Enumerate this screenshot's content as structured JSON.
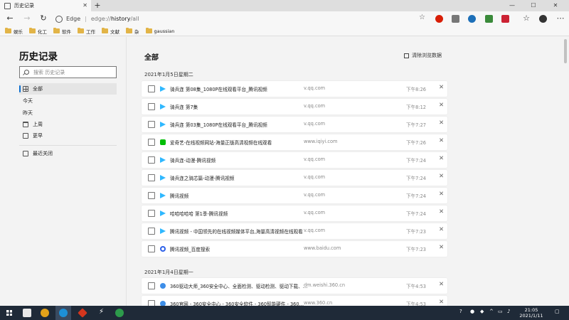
{
  "browser": {
    "tab_title": "历史记录",
    "address_scheme": "Edge",
    "address_prefix": "edge://",
    "address_host": "history",
    "address_path": "/all"
  },
  "favorites": [
    "娱乐",
    "化工",
    "软件",
    "工作",
    "文献",
    "杂",
    "gaussian"
  ],
  "sidebar": {
    "title": "历史记录",
    "search_placeholder": "搜索 历史记录",
    "items": [
      {
        "label": "全部",
        "icon": "grid-icon",
        "active": true
      },
      {
        "label": "今天",
        "icon": "clock-icon"
      },
      {
        "label": "昨天",
        "icon": "clock-icon"
      },
      {
        "label": "上周",
        "icon": "calendar-icon"
      },
      {
        "label": "更早",
        "icon": "box-icon"
      },
      {
        "label": "最近关闭",
        "icon": "closed-tabs-icon"
      }
    ]
  },
  "main": {
    "title": "全部",
    "clear_label": "清除浏览数据",
    "groups": [
      {
        "date": "2021年1月5日星期二",
        "entries": [
          {
            "title": "骑兵连 第08集_1080P在线观看平台_腾讯视频",
            "domain": "v.qq.com",
            "time": "下午8:26",
            "icon": "tencent-video-icon"
          },
          {
            "title": "骑兵连 第7集",
            "domain": "v.qq.com",
            "time": "下午8:12",
            "icon": "tencent-video-icon"
          },
          {
            "title": "骑兵连 第03集_1080P在线观看平台_腾讯视频",
            "domain": "v.qq.com",
            "time": "下午7:27",
            "icon": "tencent-video-icon"
          },
          {
            "title": "爱奇艺-在线视频网站-海量正版高清视频在线观看",
            "domain": "www.iqiyi.com",
            "time": "下午7:26",
            "icon": "iqiyi-icon"
          },
          {
            "title": "骑兵连-动漫-腾讯视频",
            "domain": "v.qq.com",
            "time": "下午7:24",
            "icon": "tencent-video-icon"
          },
          {
            "title": "骑兵连之骑芯篇-动漫-腾讯视频",
            "domain": "v.qq.com",
            "time": "下午7:24",
            "icon": "tencent-video-icon"
          },
          {
            "title": "腾讯视频",
            "domain": "v.qq.com",
            "time": "下午7:24",
            "icon": "tencent-video-icon"
          },
          {
            "title": "哈哈哈哈哈 第1季-腾讯视频",
            "domain": "v.qq.com",
            "time": "下午7:24",
            "icon": "tencent-video-icon"
          },
          {
            "title": "腾讯视频 - 中国领先的在线视频媒体平台,海量高清视频在线观看",
            "domain": "v.qq.com",
            "time": "下午7:23",
            "icon": "tencent-video-icon"
          },
          {
            "title": "腾讯视频_百度搜索",
            "domain": "www.baidu.com",
            "time": "下午7:23",
            "icon": "baidu-icon"
          }
        ]
      },
      {
        "date": "2021年1月4日星期一",
        "entries": [
          {
            "title": "360驱动大师_360安全中心、全面检测、驱动检测、驱动下载、…",
            "domain": "dm.weishi.360.cn",
            "time": "下午4:53",
            "icon": "360-icon"
          },
          {
            "title": "360官网 - 360安全中心 - 360安全软件 - 360智能硬件 - 360…",
            "domain": "www.360.cn",
            "time": "下午4:53",
            "icon": "360-icon"
          }
        ]
      }
    ]
  },
  "taskbar": {
    "time": "21:05",
    "date": "2021/1/11"
  }
}
